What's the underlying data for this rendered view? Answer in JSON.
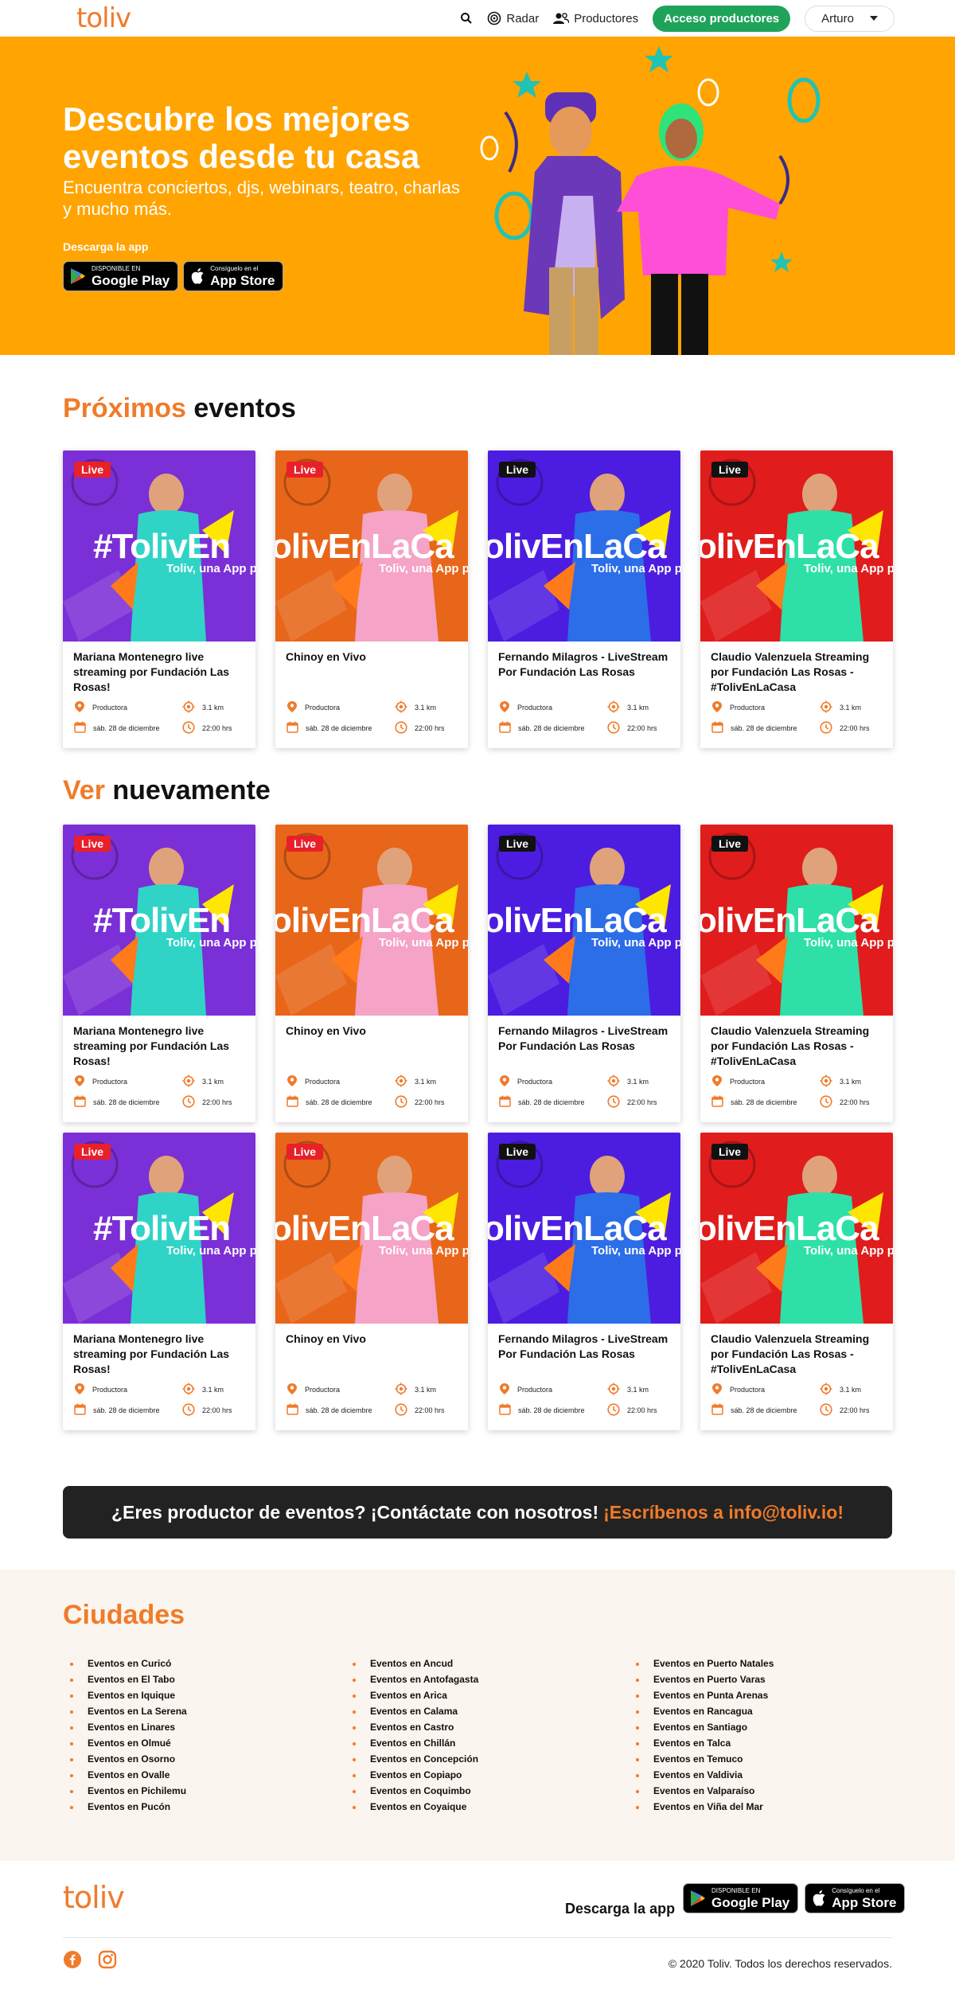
{
  "nav": {
    "logo": "toliv",
    "radar": "Radar",
    "productores": "Productores",
    "acceso": "Acceso productores",
    "user": "Arturo"
  },
  "hero": {
    "title": "Descubre los mejores eventos desde tu casa",
    "subtitle": "Encuentra conciertos, djs, webinars, teatro, charlas y mucho más.",
    "download_label": "Descarga la app",
    "google_small": "DISPONIBLE EN",
    "google_big": "Google Play",
    "apple_small": "Consíguelo en el",
    "apple_big": "App Store"
  },
  "sections": {
    "proximos_acc": "Próximos",
    "proximos_rest": " eventos",
    "ver_acc": "Ver",
    "ver_rest": " nuevamente"
  },
  "events": [
    {
      "live": "Live",
      "title": "Mariana Montenegro live streaming por Fundación Las Rosas!",
      "productora": "Productora",
      "distance": "3.1 km",
      "date": "sáb. 28 de diciembre",
      "time": "22:00 hrs",
      "hashtag": "#TolivEn",
      "bg": "#7b2fd6"
    },
    {
      "live": "Live",
      "title": "Chinoy en Vivo",
      "productora": "Productora",
      "distance": "3.1 km",
      "date": "sáb. 28 de diciembre",
      "time": "22:00 hrs",
      "hashtag": "olivEnLaCa",
      "bg": "#e8661a"
    },
    {
      "live": "Live",
      "title": "Fernando Milagros - LiveStream Por Fundación Las Rosas",
      "productora": "Productora",
      "distance": "3.1 km",
      "date": "sáb. 28 de diciembre",
      "time": "22:00 hrs",
      "hashtag": "olivEnLaCa",
      "bg": "#4c1de0"
    },
    {
      "live": "Live",
      "title": "Claudio Valenzuela Streaming por Fundación Las Rosas - #TolivEnLaCasa",
      "productora": "Productora",
      "distance": "3.1 km",
      "date": "sáb. 28 de diciembre",
      "time": "22:00 hrs",
      "hashtag": "olivEnLaCa",
      "bg": "#e01c1c"
    }
  ],
  "thumb_tagline": "Toliv, una App p",
  "banner": {
    "text": "¿Eres productor de eventos? ¡Contáctate con nosotros!",
    "accent": "¡Escríbenos a info@toliv.io!"
  },
  "cities": {
    "title": "Ciudades",
    "col1": [
      "Eventos en Curicó",
      "Eventos en El Tabo",
      "Eventos en Iquique",
      "Eventos en La Serena",
      "Eventos en Linares",
      "Eventos en Olmué",
      "Eventos en Osorno",
      "Eventos en Ovalle",
      "Eventos en Pichilemu",
      "Eventos en Pucón"
    ],
    "col2": [
      "Eventos en Ancud",
      "Eventos en Antofagasta",
      "Eventos en Arica",
      "Eventos en Calama",
      "Eventos en Castro",
      "Eventos en Chillán",
      "Eventos en Concepción",
      "Eventos en Copiapo",
      "Eventos en Coquimbo",
      "Eventos en Coyaique"
    ],
    "col3": [
      "Eventos en Puerto Natales",
      "Eventos en Puerto Varas",
      "Eventos en Punta Arenas",
      "Eventos en Rancagua",
      "Eventos en Santiago",
      "Eventos en Talca",
      "Eventos en Temuco",
      "Eventos en Valdivia",
      "Eventos en Valparaíso",
      "Eventos en Viña del Mar"
    ]
  },
  "footer": {
    "logo": "toliv",
    "download": "Descarga la app",
    "copyright": "© 2020 Toliv. Todos los derechos reservados."
  },
  "colors": {
    "orange": "#f07b2a",
    "hero_bg": "#ffa400",
    "green": "#1fa35a",
    "dark": "#222222"
  }
}
